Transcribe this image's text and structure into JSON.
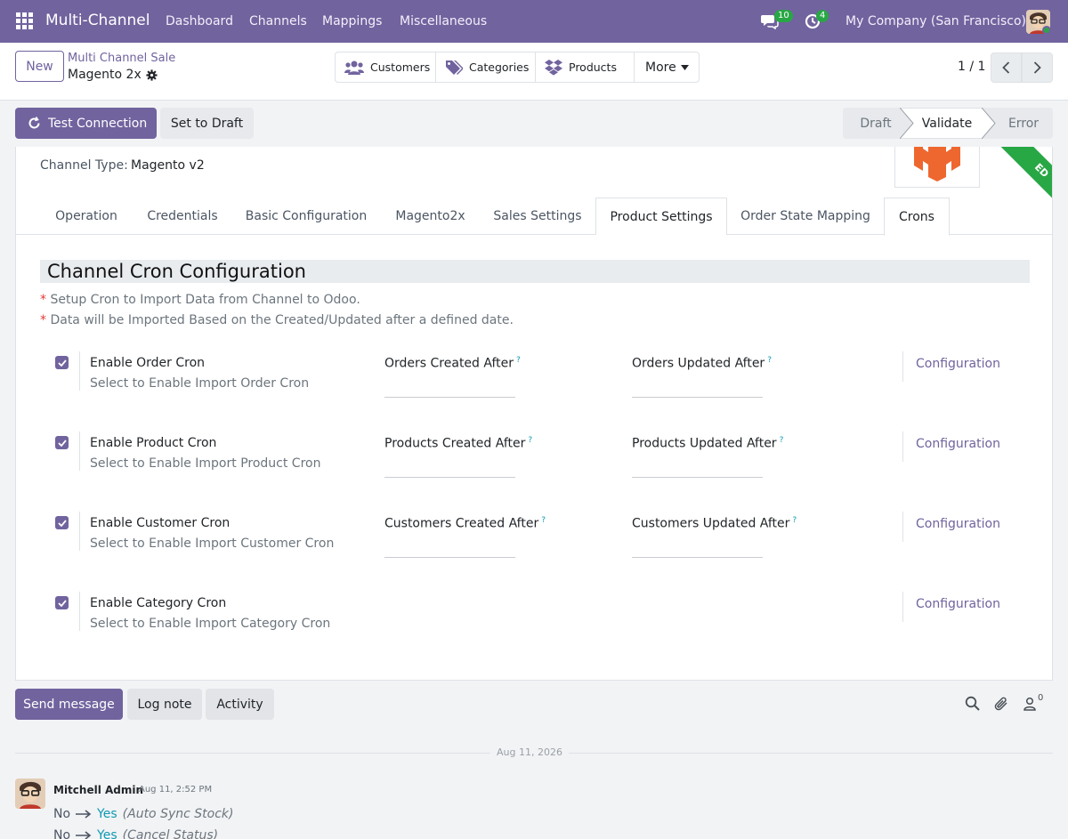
{
  "navbar": {
    "app_name": "Multi-Channel",
    "menu": [
      "Dashboard",
      "Channels",
      "Mappings",
      "Miscellaneous"
    ],
    "messages_count": "10",
    "activities_count": "4",
    "company": "My Company (San Francisco)"
  },
  "control": {
    "new_label": "New",
    "breadcrumb_parent": "Multi Channel Sale",
    "breadcrumb_current": "Magento 2x",
    "smart_buttons": [
      "Customers",
      "Categories",
      "Products",
      "More"
    ],
    "pager": "1 / 1"
  },
  "statusbar": {
    "test_connection": "Test Connection",
    "set_to_draft": "Set to Draft",
    "stages": [
      "Draft",
      "Validate",
      "Error"
    ],
    "active_stage": "Validate"
  },
  "sheet": {
    "ribbon": "ED",
    "channel_type_label": "Channel Type:",
    "channel_type_value": "Magento v2",
    "tabs": [
      "Operation",
      "Credentials",
      "Basic Configuration",
      "Magento2x",
      "Sales Settings",
      "Product Settings",
      "Order State Mapping",
      "Crons"
    ],
    "active_tab": "Crons",
    "section_title": "Channel Cron Configuration",
    "notes": [
      "Setup Cron to Import Data from Channel to Odoo.",
      "Data will be Imported Based on the Created/Updated after a defined date."
    ],
    "note_marker": "*",
    "help_marker": "?",
    "crons": [
      {
        "label": "Enable Order Cron",
        "help": "Select to Enable Import Order Cron",
        "checked": true,
        "created": "Orders Created After",
        "updated": "Orders Updated After",
        "config": "Configuration"
      },
      {
        "label": "Enable Product Cron",
        "help": "Select to Enable Import Product Cron",
        "checked": true,
        "created": "Products Created After",
        "updated": "Products Updated After",
        "config": "Configuration"
      },
      {
        "label": "Enable Customer Cron",
        "help": "Select to Enable Import Customer Cron",
        "checked": true,
        "created": "Customers Created After",
        "updated": "Customers Updated After",
        "config": "Configuration"
      },
      {
        "label": "Enable Category Cron",
        "help": "Select to Enable Import Category Cron",
        "checked": true,
        "config": "Configuration"
      }
    ]
  },
  "chatter": {
    "send_message": "Send message",
    "log_note": "Log note",
    "activity": "Activity",
    "followers_count": "0",
    "date": "Aug 11, 2026",
    "message": {
      "author": "Mitchell Admin",
      "time": "Aug 11, 2:52 PM",
      "changes": [
        {
          "old": "No",
          "new": "Yes",
          "field": "(Auto Sync Stock)"
        },
        {
          "old": "No",
          "new": "Yes",
          "field": "(Cancel Status)"
        }
      ]
    }
  },
  "colors": {
    "brand": "#71639e",
    "success": "#28a745",
    "link": "#0e9ab2",
    "magento": "#ee672f"
  }
}
